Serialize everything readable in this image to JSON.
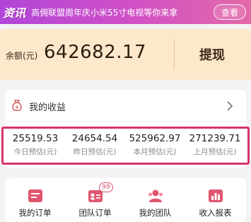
{
  "news": {
    "tag": "资讯",
    "text": "高佣联盟周年庆小米55寸电视等你来拿",
    "button": "查看"
  },
  "balance": {
    "label": "余额(元)",
    "value": "642682.17",
    "withdraw": "提现"
  },
  "earnings": {
    "title": "我的收益",
    "stats": [
      {
        "value": "25519.53",
        "label": "今日预估(元)"
      },
      {
        "value": "24654.54",
        "label": "昨日预估(元)"
      },
      {
        "value": "525962.97",
        "label": "本月预估(元)"
      },
      {
        "value": "271239.71",
        "label": "上月预估(元)"
      }
    ]
  },
  "menu": {
    "items": [
      {
        "label": "我的订单",
        "icon": "order-icon"
      },
      {
        "label": "团队订单",
        "icon": "team-order-icon",
        "badge": "99"
      },
      {
        "label": "我的团队",
        "icon": "team-icon"
      },
      {
        "label": "收入报表",
        "icon": "report-icon"
      }
    ]
  },
  "colors": {
    "banner_start": "#b046d8",
    "banner_end": "#e36aa8",
    "balance_bg": "#fde8cc",
    "highlight_border": "#d7336b",
    "menu_icon": "#e0566e"
  }
}
